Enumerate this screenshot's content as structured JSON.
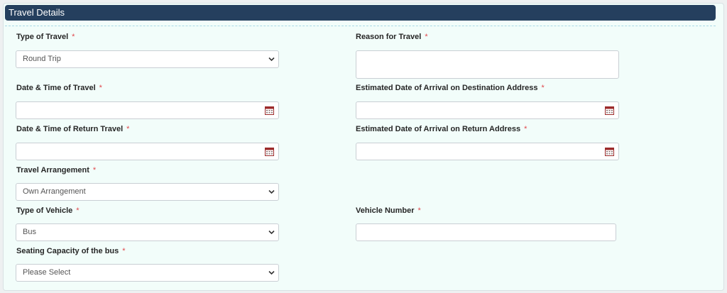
{
  "panel": {
    "title": "Travel Details"
  },
  "required_marker": "*",
  "fields": {
    "type_of_travel": {
      "label": "Type of Travel",
      "value": "Round Trip"
    },
    "reason_for_travel": {
      "label": "Reason for Travel",
      "value": ""
    },
    "date_time_travel": {
      "label": "Date & Time of Travel",
      "value": ""
    },
    "eta_destination": {
      "label": "Estimated Date of Arrival on Destination Address",
      "value": ""
    },
    "date_time_return": {
      "label": "Date & Time of Return Travel",
      "value": ""
    },
    "eta_return": {
      "label": "Estimated Date of Arrival on Return Address",
      "value": ""
    },
    "travel_arrangement": {
      "label": "Travel Arrangement",
      "value": "Own Arrangement"
    },
    "type_of_vehicle": {
      "label": "Type of Vehicle",
      "value": "Bus"
    },
    "vehicle_number": {
      "label": "Vehicle Number",
      "value": ""
    },
    "seating_capacity": {
      "label": "Seating Capacity of the bus",
      "value": "Please Select"
    }
  },
  "icons": {
    "select_arrow": "chevron-down-icon",
    "date_picker": "calendar-icon"
  },
  "colors": {
    "header_bg": "#253f5e",
    "required": "#e0474c",
    "calendar_icon": "#9c2b2b"
  }
}
